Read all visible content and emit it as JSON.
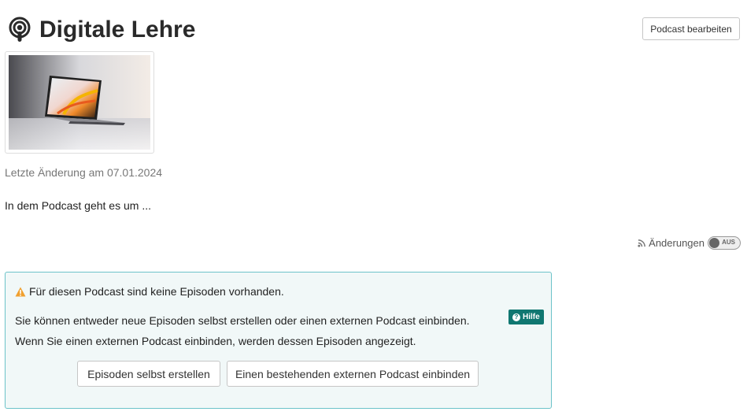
{
  "header": {
    "title": "Digitale Lehre",
    "icon": "podcast-icon"
  },
  "toolbar": {
    "edit_label": "Podcast bearbeiten"
  },
  "meta": {
    "last_change": "Letzte Änderung am 07.01.2024"
  },
  "description": "In dem Podcast geht es um ...",
  "changes": {
    "label": "Änderungen",
    "toggle_state": "AUS",
    "icon": "rss-icon"
  },
  "info": {
    "warning": "Für diesen Podcast sind keine Episoden vorhanden.",
    "text": "Sie können entweder neue Episoden selbst erstellen oder einen externen Podcast einbinden. Wenn Sie einen externen Podcast einbinden, werden dessen Episoden angezeigt.",
    "help_label": "Hilfe",
    "create_label": "Episoden selbst erstellen",
    "embed_label": "Einen bestehenden externen Podcast einbinden"
  },
  "colors": {
    "accent": "#107771",
    "info_border": "#6cc3c9",
    "info_bg": "#f1f8f8",
    "warning": "#f0a030"
  }
}
